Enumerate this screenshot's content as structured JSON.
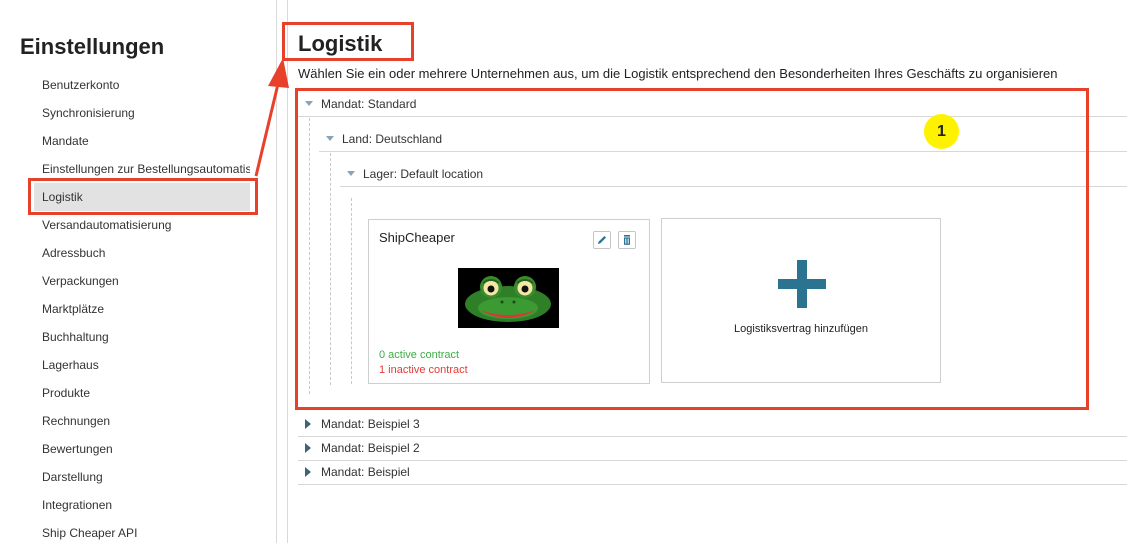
{
  "sidebar": {
    "title": "Einstellungen",
    "items": [
      {
        "label": "Benutzerkonto"
      },
      {
        "label": "Synchronisierung"
      },
      {
        "label": "Mandate"
      },
      {
        "label": "Einstellungen zur Bestellungsautomatisierung"
      },
      {
        "label": "Logistik",
        "active": true
      },
      {
        "label": "Versandautomatisierung"
      },
      {
        "label": "Adressbuch"
      },
      {
        "label": "Verpackungen"
      },
      {
        "label": "Marktplätze"
      },
      {
        "label": "Buchhaltung"
      },
      {
        "label": "Lagerhaus"
      },
      {
        "label": "Produkte"
      },
      {
        "label": "Rechnungen"
      },
      {
        "label": "Bewertungen"
      },
      {
        "label": "Darstellung"
      },
      {
        "label": "Integrationen"
      },
      {
        "label": "Ship Cheaper API"
      }
    ]
  },
  "main": {
    "title": "Logistik",
    "subtitle": "Wählen Sie ein oder mehrere Unternehmen aus, um die Logistik entsprechend den Besonderheiten Ihres Geschäfts zu organisieren",
    "mandate_expanded": {
      "label": "Mandat: Standard",
      "country": {
        "label": "Land: Deutschland",
        "warehouse": {
          "label": "Lager: Default location",
          "carrier_card": {
            "name": "ShipCheaper",
            "active_contracts": "0 active contract",
            "inactive_contracts": "1 inactive contract",
            "logo": "frog-logo"
          },
          "add_card": {
            "label": "Logistiksvertrag hinzufügen",
            "icon": "plus-icon"
          }
        }
      }
    },
    "mandates_collapsed": [
      {
        "label": "Mandat: Beispiel 3"
      },
      {
        "label": "Mandat: Beispiel 2"
      },
      {
        "label": "Mandat: Beispiel"
      }
    ]
  },
  "annotations": {
    "badge": "1",
    "highlight_color": "#e8412b",
    "badge_color": "#fff200"
  },
  "colors": {
    "active_contract": "#3fae45",
    "inactive_contract": "#e53935",
    "accent": "#2a7391",
    "nav_active_bg": "#e2e2e2"
  }
}
